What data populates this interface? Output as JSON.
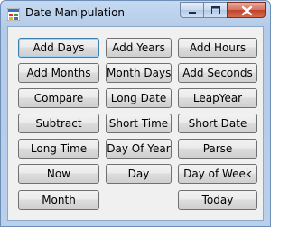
{
  "window": {
    "title": "Date Manipulation",
    "icon": "windows-forms-app-icon",
    "controls": [
      "minimize-icon",
      "maximize-icon",
      "close-icon"
    ]
  },
  "buttons": {
    "add_days": "Add Days",
    "add_years": "Add Years",
    "add_hours": "Add Hours",
    "add_months": "Add Months",
    "month_days": "Month Days",
    "add_seconds": "Add Seconds",
    "compare": "Compare",
    "long_date": "Long Date",
    "leap_year": "LeapYear",
    "subtract": "Subtract",
    "short_time": "Short Time",
    "short_date": "Short Date",
    "long_time": "Long Time",
    "day_of_year": "Day Of Year",
    "parse": "Parse",
    "now": "Now",
    "day": "Day",
    "day_of_week": "Day of Week",
    "month": "Month",
    "today": "Today"
  }
}
